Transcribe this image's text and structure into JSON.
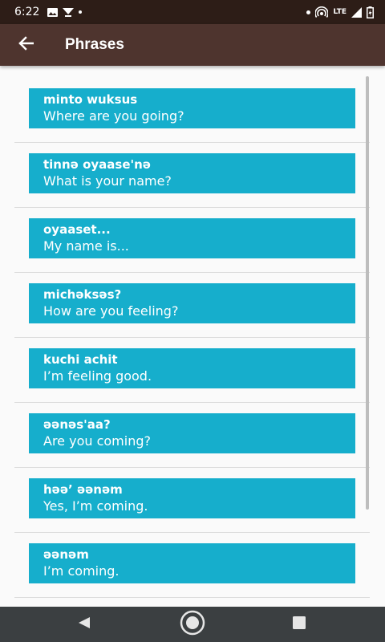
{
  "status_bar": {
    "time": "6:22",
    "network_label": "LTE",
    "left_icons": [
      "image-icon",
      "download-icon",
      "dot-icon"
    ],
    "right_icons": [
      "dot-icon",
      "hotspot-icon",
      "lte-icon",
      "signal-icon",
      "battery-icon"
    ]
  },
  "app_bar": {
    "title": "Phrases",
    "back_icon": "arrow-back-icon"
  },
  "phrases": [
    {
      "native": "minto wuksus",
      "english": "Where are you going?"
    },
    {
      "native": "tinnə oyaase'nə",
      "english": "What is your name?"
    },
    {
      "native": "oyaaset...",
      "english": "My name is..."
    },
    {
      "native": "michəksəs?",
      "english": "How are you feeling?"
    },
    {
      "native": "kuchi achit",
      "english": "I’m feeling good."
    },
    {
      "native": "əənəs'aa?",
      "english": "Are you coming?"
    },
    {
      "native": "həə’ əənəm",
      "english": "Yes, I’m coming."
    },
    {
      "native": "əənəm",
      "english": "I’m coming."
    }
  ],
  "nav_bar": {
    "icons": [
      "back-triangle-icon",
      "home-circle-icon",
      "recents-square-icon"
    ]
  },
  "colors": {
    "status_bar": "#2d1d17",
    "app_bar": "#4e342e",
    "card": "#16aecc",
    "nav_bar": "#3b3f41",
    "background": "#fafafa"
  }
}
